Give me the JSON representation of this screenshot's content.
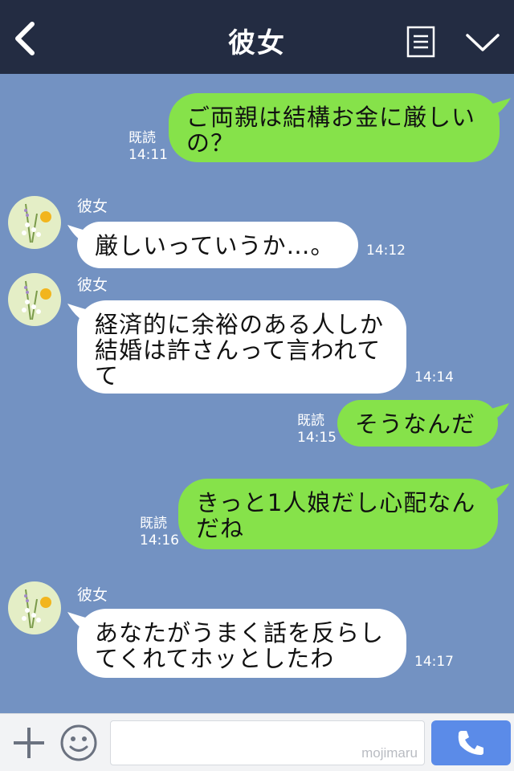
{
  "header": {
    "title": "彼女",
    "back_icon": "chevron-left-icon",
    "menu_icon": "list-icon",
    "collapse_icon": "chevron-down-icon"
  },
  "colors": {
    "header_bg": "#232c42",
    "chat_bg": "#7392c2",
    "sent_bubble": "#86e24a",
    "received_bubble": "#ffffff",
    "call_button": "#5b8be8"
  },
  "messages": [
    {
      "direction": "sent",
      "lines": [
        "ご両親は結構お金に厳しい",
        "の？"
      ],
      "read": "既読",
      "time": "14:11"
    },
    {
      "direction": "received",
      "sender": "彼女",
      "lines": [
        "厳しいっていうか…。"
      ],
      "time": "14:12"
    },
    {
      "direction": "received",
      "sender": "彼女",
      "lines": [
        "経済的に余裕のある人しか",
        "結婚は許さんって言われて",
        "て"
      ],
      "time": "14:14"
    },
    {
      "direction": "sent",
      "lines": [
        "そうなんだ"
      ],
      "read": "既読",
      "time": "14:15"
    },
    {
      "direction": "sent",
      "lines": [
        "きっと1人娘だし心配なん",
        "だね"
      ],
      "read": "既読",
      "time": "14:16"
    },
    {
      "direction": "received",
      "sender": "彼女",
      "lines": [
        "あなたがうまく話を反らし",
        "てくれてホッとしたわ"
      ],
      "time": "14:17"
    }
  ],
  "bottom_bar": {
    "plus_icon": "plus-icon",
    "sticker_icon": "smiley-icon",
    "input_value": "",
    "watermark": "mojimaru",
    "call_icon": "phone-icon"
  }
}
